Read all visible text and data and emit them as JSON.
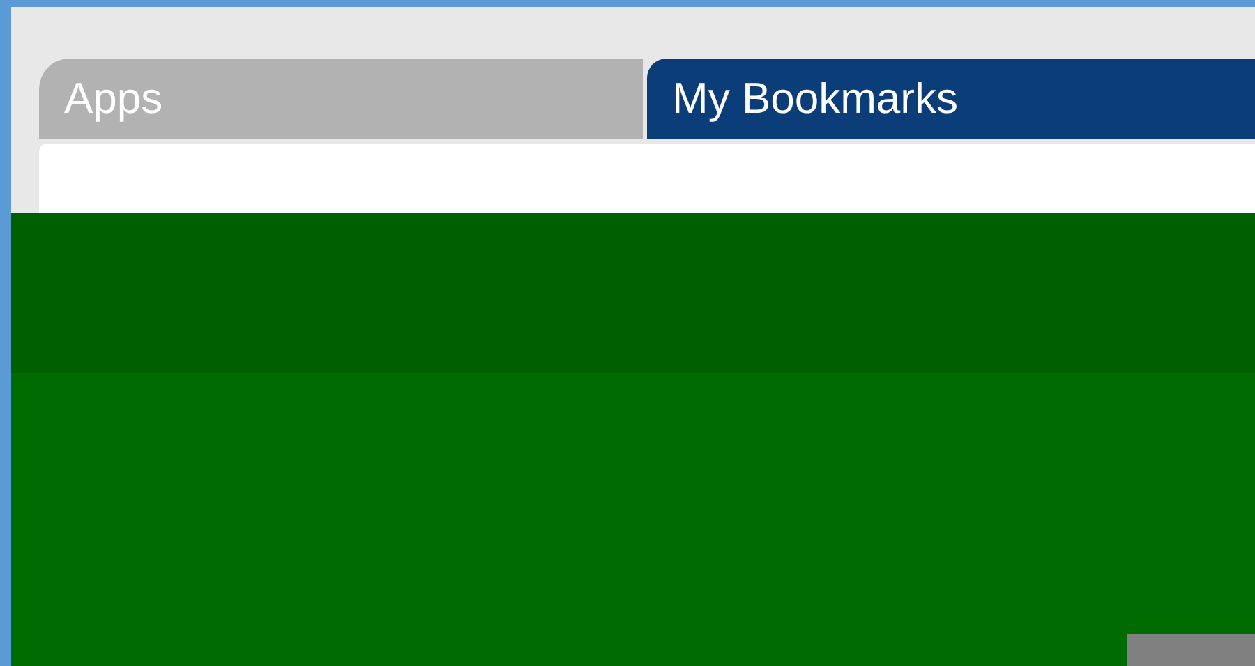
{
  "tabs": [
    {
      "label": "Apps",
      "selected": false
    },
    {
      "label": "My Bookmarks",
      "selected": true
    }
  ]
}
